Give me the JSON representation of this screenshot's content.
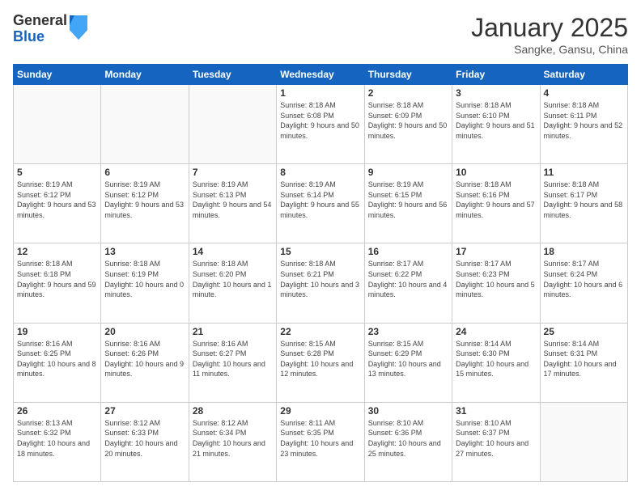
{
  "logo": {
    "general": "General",
    "blue": "Blue"
  },
  "title": "January 2025",
  "location": "Sangke, Gansu, China",
  "days_header": [
    "Sunday",
    "Monday",
    "Tuesday",
    "Wednesday",
    "Thursday",
    "Friday",
    "Saturday"
  ],
  "weeks": [
    [
      {
        "day": "",
        "info": ""
      },
      {
        "day": "",
        "info": ""
      },
      {
        "day": "",
        "info": ""
      },
      {
        "day": "1",
        "info": "Sunrise: 8:18 AM\nSunset: 6:08 PM\nDaylight: 9 hours\nand 50 minutes."
      },
      {
        "day": "2",
        "info": "Sunrise: 8:18 AM\nSunset: 6:09 PM\nDaylight: 9 hours\nand 50 minutes."
      },
      {
        "day": "3",
        "info": "Sunrise: 8:18 AM\nSunset: 6:10 PM\nDaylight: 9 hours\nand 51 minutes."
      },
      {
        "day": "4",
        "info": "Sunrise: 8:18 AM\nSunset: 6:11 PM\nDaylight: 9 hours\nand 52 minutes."
      }
    ],
    [
      {
        "day": "5",
        "info": "Sunrise: 8:19 AM\nSunset: 6:12 PM\nDaylight: 9 hours\nand 53 minutes."
      },
      {
        "day": "6",
        "info": "Sunrise: 8:19 AM\nSunset: 6:12 PM\nDaylight: 9 hours\nand 53 minutes."
      },
      {
        "day": "7",
        "info": "Sunrise: 8:19 AM\nSunset: 6:13 PM\nDaylight: 9 hours\nand 54 minutes."
      },
      {
        "day": "8",
        "info": "Sunrise: 8:19 AM\nSunset: 6:14 PM\nDaylight: 9 hours\nand 55 minutes."
      },
      {
        "day": "9",
        "info": "Sunrise: 8:19 AM\nSunset: 6:15 PM\nDaylight: 9 hours\nand 56 minutes."
      },
      {
        "day": "10",
        "info": "Sunrise: 8:18 AM\nSunset: 6:16 PM\nDaylight: 9 hours\nand 57 minutes."
      },
      {
        "day": "11",
        "info": "Sunrise: 8:18 AM\nSunset: 6:17 PM\nDaylight: 9 hours\nand 58 minutes."
      }
    ],
    [
      {
        "day": "12",
        "info": "Sunrise: 8:18 AM\nSunset: 6:18 PM\nDaylight: 9 hours\nand 59 minutes."
      },
      {
        "day": "13",
        "info": "Sunrise: 8:18 AM\nSunset: 6:19 PM\nDaylight: 10 hours\nand 0 minutes."
      },
      {
        "day": "14",
        "info": "Sunrise: 8:18 AM\nSunset: 6:20 PM\nDaylight: 10 hours\nand 1 minute."
      },
      {
        "day": "15",
        "info": "Sunrise: 8:18 AM\nSunset: 6:21 PM\nDaylight: 10 hours\nand 3 minutes."
      },
      {
        "day": "16",
        "info": "Sunrise: 8:17 AM\nSunset: 6:22 PM\nDaylight: 10 hours\nand 4 minutes."
      },
      {
        "day": "17",
        "info": "Sunrise: 8:17 AM\nSunset: 6:23 PM\nDaylight: 10 hours\nand 5 minutes."
      },
      {
        "day": "18",
        "info": "Sunrise: 8:17 AM\nSunset: 6:24 PM\nDaylight: 10 hours\nand 6 minutes."
      }
    ],
    [
      {
        "day": "19",
        "info": "Sunrise: 8:16 AM\nSunset: 6:25 PM\nDaylight: 10 hours\nand 8 minutes."
      },
      {
        "day": "20",
        "info": "Sunrise: 8:16 AM\nSunset: 6:26 PM\nDaylight: 10 hours\nand 9 minutes."
      },
      {
        "day": "21",
        "info": "Sunrise: 8:16 AM\nSunset: 6:27 PM\nDaylight: 10 hours\nand 11 minutes."
      },
      {
        "day": "22",
        "info": "Sunrise: 8:15 AM\nSunset: 6:28 PM\nDaylight: 10 hours\nand 12 minutes."
      },
      {
        "day": "23",
        "info": "Sunrise: 8:15 AM\nSunset: 6:29 PM\nDaylight: 10 hours\nand 13 minutes."
      },
      {
        "day": "24",
        "info": "Sunrise: 8:14 AM\nSunset: 6:30 PM\nDaylight: 10 hours\nand 15 minutes."
      },
      {
        "day": "25",
        "info": "Sunrise: 8:14 AM\nSunset: 6:31 PM\nDaylight: 10 hours\nand 17 minutes."
      }
    ],
    [
      {
        "day": "26",
        "info": "Sunrise: 8:13 AM\nSunset: 6:32 PM\nDaylight: 10 hours\nand 18 minutes."
      },
      {
        "day": "27",
        "info": "Sunrise: 8:12 AM\nSunset: 6:33 PM\nDaylight: 10 hours\nand 20 minutes."
      },
      {
        "day": "28",
        "info": "Sunrise: 8:12 AM\nSunset: 6:34 PM\nDaylight: 10 hours\nand 21 minutes."
      },
      {
        "day": "29",
        "info": "Sunrise: 8:11 AM\nSunset: 6:35 PM\nDaylight: 10 hours\nand 23 minutes."
      },
      {
        "day": "30",
        "info": "Sunrise: 8:10 AM\nSunset: 6:36 PM\nDaylight: 10 hours\nand 25 minutes."
      },
      {
        "day": "31",
        "info": "Sunrise: 8:10 AM\nSunset: 6:37 PM\nDaylight: 10 hours\nand 27 minutes."
      },
      {
        "day": "",
        "info": ""
      }
    ]
  ]
}
